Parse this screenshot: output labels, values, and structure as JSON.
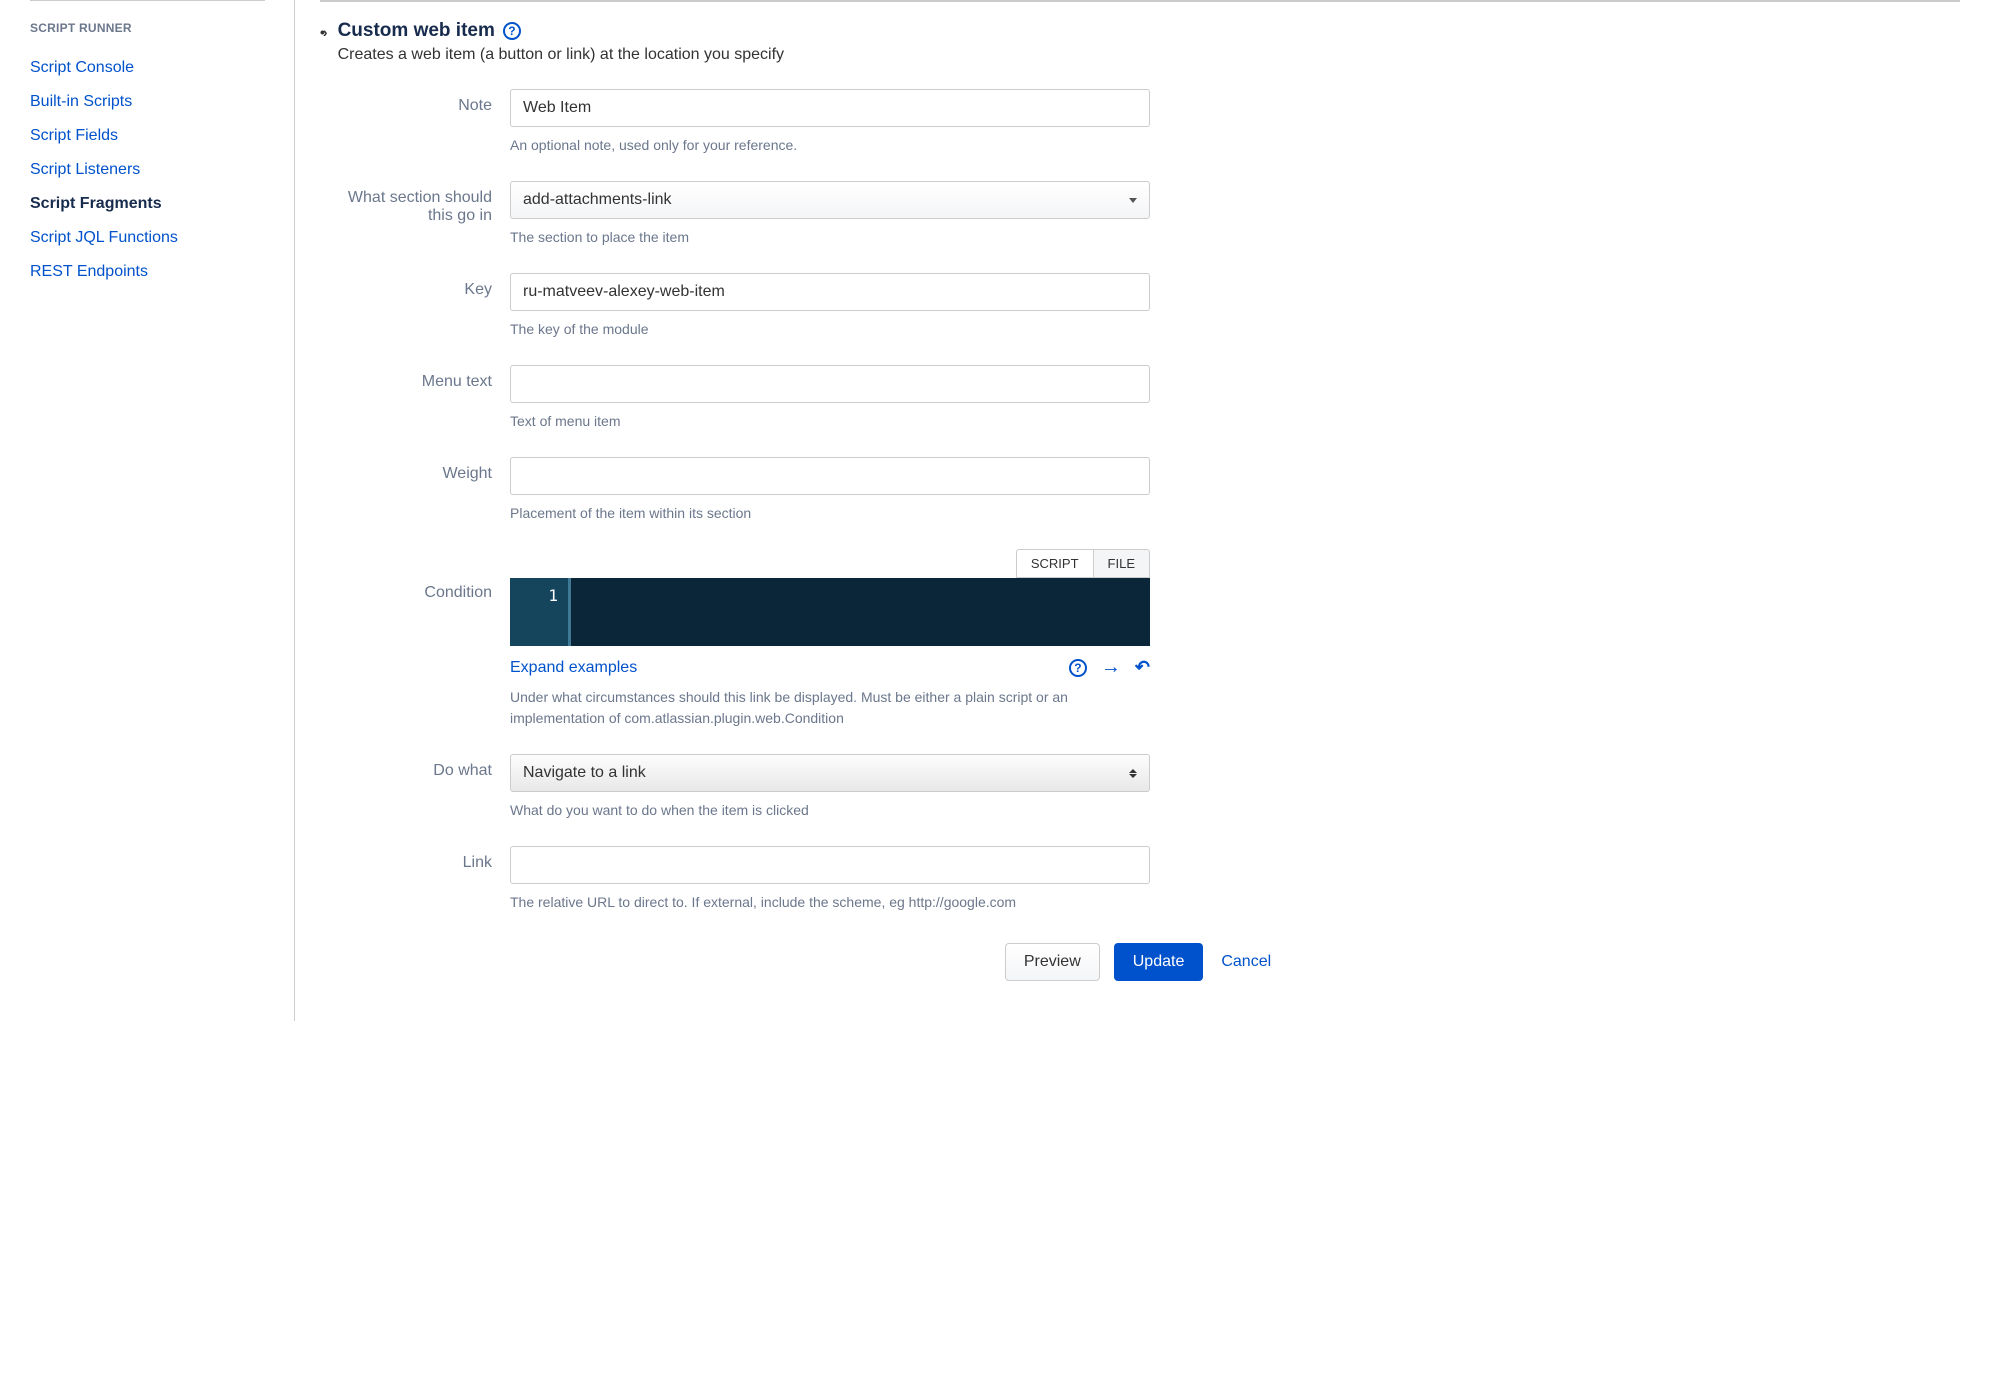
{
  "sidebar": {
    "heading": "SCRIPT RUNNER",
    "items": [
      {
        "label": "Script Console",
        "active": false
      },
      {
        "label": "Built-in Scripts",
        "active": false
      },
      {
        "label": "Script Fields",
        "active": false
      },
      {
        "label": "Script Listeners",
        "active": false
      },
      {
        "label": "Script Fragments",
        "active": true
      },
      {
        "label": "Script JQL Functions",
        "active": false
      },
      {
        "label": "REST Endpoints",
        "active": false
      }
    ]
  },
  "header": {
    "title": "Custom web item",
    "subtitle": "Creates a web item (a button or link) at the location you specify"
  },
  "fields": {
    "note": {
      "label": "Note",
      "value": "Web Item",
      "help": "An optional note, used only for your reference."
    },
    "section": {
      "label": "What section should this go in",
      "value": "add-attachments-link",
      "help": "The section to place the item"
    },
    "key": {
      "label": "Key",
      "value": "ru-matveev-alexey-web-item",
      "help": "The key of the module"
    },
    "menuText": {
      "label": "Menu text",
      "value": "",
      "help": "Text of menu item"
    },
    "weight": {
      "label": "Weight",
      "value": "",
      "help": "Placement of the item within its section"
    },
    "condition": {
      "label": "Condition",
      "tabScript": "SCRIPT",
      "tabFile": "FILE",
      "lineNumber": "1",
      "expand": "Expand examples",
      "help": "Under what circumstances should this link be displayed. Must be either a plain script or an implementation of com.atlassian.plugin.web.Condition"
    },
    "doWhat": {
      "label": "Do what",
      "value": "Navigate to a link",
      "help": "What do you want to do when the item is clicked"
    },
    "link": {
      "label": "Link",
      "value": "",
      "help": "The relative URL to direct to. If external, include the scheme, eg http://google.com"
    }
  },
  "buttons": {
    "preview": "Preview",
    "update": "Update",
    "cancel": "Cancel"
  }
}
